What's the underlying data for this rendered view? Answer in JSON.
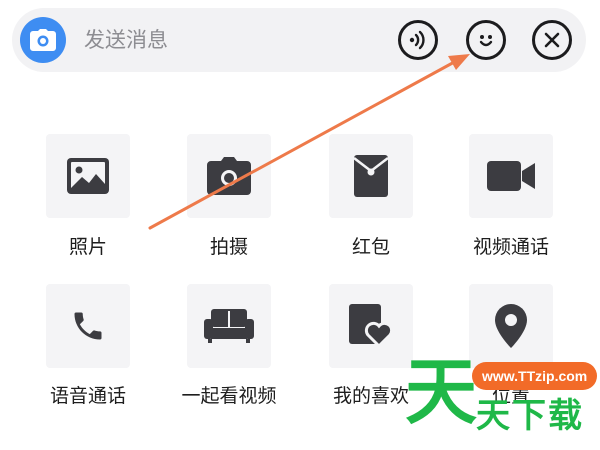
{
  "input_bar": {
    "placeholder": "发送消息",
    "camera_icon": "camera-icon",
    "voice_icon": "voice-wave-icon",
    "emoji_icon": "smiley-icon",
    "close_icon": "close-icon"
  },
  "actions": [
    {
      "label": "照片",
      "icon": "photo-icon"
    },
    {
      "label": "拍摄",
      "icon": "camera-icon"
    },
    {
      "label": "红包",
      "icon": "red-packet-icon"
    },
    {
      "label": "视频通话",
      "icon": "video-call-icon"
    },
    {
      "label": "语音通话",
      "icon": "phone-icon"
    },
    {
      "label": "一起看视频",
      "icon": "sofa-icon"
    },
    {
      "label": "我的喜欢",
      "icon": "liked-icon"
    },
    {
      "label": "位置",
      "icon": "location-pin-icon"
    }
  ],
  "watermark": {
    "url": "www.TTzip.com",
    "big_char": "天",
    "small_text": "天下载"
  },
  "colors": {
    "accent_blue": "#3e8df2",
    "icon_dark": "#3c3c41",
    "arrow": "#ee7a4a",
    "watermark_green": "#1fb848",
    "watermark_orange": "#f26b28"
  }
}
